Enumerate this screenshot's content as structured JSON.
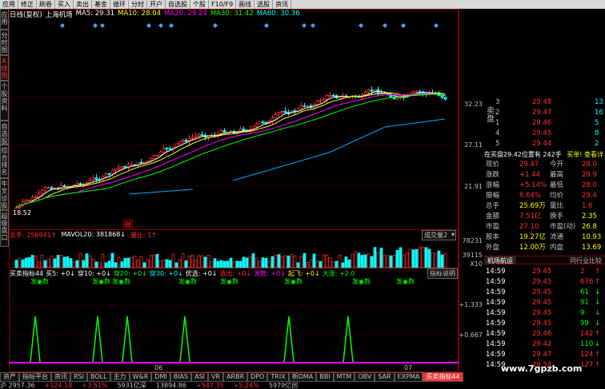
{
  "toolbar": {
    "items": [
      "应用",
      "修正",
      "刷卷",
      "买入",
      "卖出",
      "基金",
      "循环",
      "分时",
      "开户",
      "自选股",
      "个股",
      "F10/F9",
      "画线",
      "选股",
      "资讯"
    ]
  },
  "left_tabs": [
    "应用",
    "分时图",
    "K线图",
    "个股资料",
    "自选股",
    "综合排名",
    "牛叉诊股",
    "超级盘口"
  ],
  "chart_header": {
    "mode": "日线(复权)",
    "stock": "上海机场",
    "ma5": "MA5: 29.31",
    "ma10": "MA10: 28.04",
    "ma20": "MA20: 29.24",
    "ma30": "MA30: 31.42",
    "ma60": "MA60: 30.36"
  },
  "price_axis": {
    "p1": "32.23",
    "p2": "27.11",
    "p3": "21.91"
  },
  "price_low_label": "18.52",
  "event_marker": "财",
  "volume_header": {
    "total": "总手: 256941↑",
    "mavol": "MAVOL20: 381868↓",
    "ratio": "量比: 1↑"
  },
  "volume_dropdown": "成交量2",
  "volume_axis": {
    "v1": "78231",
    "v2": "39115",
    "v3": "X10"
  },
  "indicator_header": {
    "name": "买卖指标44",
    "b5": "买5: +0↓",
    "c10": "穿10: +0↓",
    "c20": "穿20: +0↓",
    "c30": "穿30: +0↓",
    "youxuan": "优选: +0↓",
    "xuanchu": "选出: +0↓",
    "fa": "发数: +0↓",
    "qifei": "起飞: +0↓",
    "dazhang": "大涨: +2.0"
  },
  "indicator_help": "指标说明",
  "indicator_axis": {
    "a1": "+1.333",
    "a2": "+0.667"
  },
  "buy_signals": [
    "发◉数",
    "发◉数",
    "发◉数",
    "发◉数",
    "发◉数",
    "发◉数",
    "发◉数",
    "发◉数"
  ],
  "months": [
    "06",
    "07"
  ],
  "quote": {
    "asks": [
      {
        "lvl": "3",
        "price": "29.48",
        "vol": "13"
      },
      {
        "lvl": "2",
        "price": "29.47",
        "vol": "16"
      },
      {
        "lvl": "1",
        "price": "29.46",
        "vol": "5"
      },
      {
        "lvl": "4",
        "price": "29.45",
        "vol": "8"
      },
      {
        "lvl": "5",
        "price": "29.44",
        "vol": "2"
      }
    ],
    "ask_side_label": "卖盘",
    "bid_side_label": "买盘",
    "summary": "在买盘29.42位置有 242手",
    "links": "买单! 查看详",
    "rows": [
      [
        "现价",
        "29.47",
        "今开",
        "28.0"
      ],
      [
        "涨跌",
        "+1.44",
        "最高",
        "29.9"
      ],
      [
        "涨幅",
        "+5.14%",
        "最低",
        "28.0"
      ],
      [
        "振幅",
        "6.64%",
        "均价",
        "29.4"
      ],
      [
        "总手",
        "25.69万",
        "量比",
        "1.6"
      ],
      [
        "金额",
        "7.51亿",
        "换手",
        "2.35"
      ],
      [
        "市盈",
        "27.10",
        "市盈(动)",
        "26.8"
      ],
      [
        "股本",
        "19.27亿",
        "流通",
        "10.93"
      ],
      [
        "外盘",
        "12.00万",
        "内盘",
        "13.69"
      ]
    ],
    "tabs": [
      "机场航运",
      "同行业比较"
    ],
    "ticks": [
      {
        "time": "14:59",
        "price": "29.45",
        "vol": "2",
        "arrow": "↑"
      },
      {
        "time": "14:59",
        "price": "29.45",
        "vol": "676",
        "arrow": "↑"
      },
      {
        "time": "14:59",
        "price": "29.45",
        "vol": "61",
        "arrow": "↓"
      },
      {
        "time": "14:59",
        "price": "29.45",
        "vol": "91",
        "arrow": "↓"
      },
      {
        "time": "14:59",
        "price": "29.45",
        "vol": "9",
        "arrow": "↓"
      },
      {
        "time": "14:59",
        "price": "29.45",
        "vol": "99",
        "arrow": "↓"
      },
      {
        "time": "14:59",
        "price": "29.46",
        "vol": "142",
        "arrow": "↑"
      },
      {
        "time": "14:59",
        "price": "29.42",
        "vol": "110",
        "arrow": "↓"
      },
      {
        "time": "14:59",
        "price": "29.47",
        "vol": "124",
        "arrow": "↑"
      },
      {
        "time": "14:59",
        "price": "29.54",
        "vol": "127",
        "arrow": "↑"
      }
    ]
  },
  "bottom_tabs": [
    "资产",
    "指标平台",
    "资讯",
    "RSI",
    "BOLL",
    "主力",
    "W&R",
    "DMI",
    "BIAS",
    "ASI",
    "VR",
    "ARBR",
    "DPO",
    "TRIX",
    "新DMA",
    "BBI",
    "MTM",
    "OBV",
    "SAR",
    "EXPMA",
    "买卖指标44"
  ],
  "statusbar": [
    "沪 2957.36",
    "+124.18",
    "+3.51%",
    "5931亿深",
    "13894.86",
    "+547.35",
    "+5.24%",
    "5979亿创"
  ],
  "watermark": "www.7gpzb.com"
}
